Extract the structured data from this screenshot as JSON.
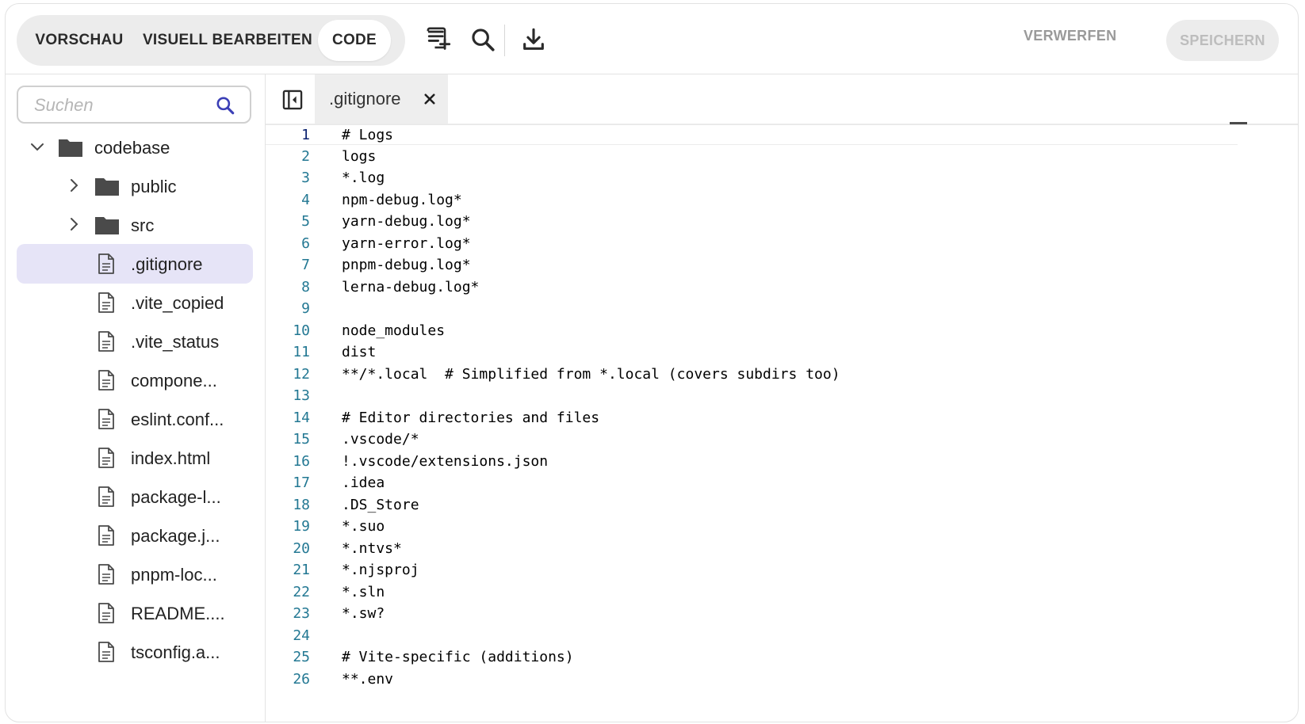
{
  "toolbar": {
    "modes": [
      {
        "label": "VORSCHAU",
        "active": false
      },
      {
        "label": "VISUELL BEARBEITEN",
        "active": false
      },
      {
        "label": "CODE",
        "active": true
      }
    ],
    "icons": [
      "add-file-icon",
      "search-icon",
      "download-icon"
    ],
    "discard_label": "VERWERFEN",
    "save_label": "SPEICHERN"
  },
  "sidebar": {
    "search_placeholder": "Suchen",
    "tree": [
      {
        "label": "codebase",
        "type": "folder",
        "expanded": true,
        "depth": 0
      },
      {
        "label": "public",
        "type": "folder",
        "expanded": false,
        "depth": 1
      },
      {
        "label": "src",
        "type": "folder",
        "expanded": false,
        "depth": 1
      },
      {
        "label": ".gitignore",
        "type": "file",
        "selected": true,
        "depth": 1
      },
      {
        "label": ".vite_copied",
        "type": "file",
        "depth": 1
      },
      {
        "label": ".vite_status",
        "type": "file",
        "depth": 1
      },
      {
        "label": "compone...",
        "type": "file",
        "depth": 1
      },
      {
        "label": "eslint.conf...",
        "type": "file",
        "depth": 1
      },
      {
        "label": "index.html",
        "type": "file",
        "depth": 1
      },
      {
        "label": "package-l...",
        "type": "file",
        "depth": 1
      },
      {
        "label": "package.j...",
        "type": "file",
        "depth": 1
      },
      {
        "label": "pnpm-loc...",
        "type": "file",
        "depth": 1
      },
      {
        "label": "README....",
        "type": "file",
        "depth": 1
      },
      {
        "label": "tsconfig.a...",
        "type": "file",
        "depth": 1
      }
    ]
  },
  "editor": {
    "tab": {
      "label": ".gitignore"
    },
    "active_line": 1,
    "lines": [
      "# Logs",
      "logs",
      "*.log",
      "npm-debug.log*",
      "yarn-debug.log*",
      "yarn-error.log*",
      "pnpm-debug.log*",
      "lerna-debug.log*",
      "",
      "node_modules",
      "dist",
      "**/*.local  # Simplified from *.local (covers subdirs too)",
      "",
      "# Editor directories and files",
      ".vscode/*",
      "!.vscode/extensions.json",
      ".idea",
      ".DS_Store",
      "*.suo",
      "*.ntvs*",
      "*.njsproj",
      "*.sln",
      "*.sw?",
      "",
      "# Vite-specific (additions)",
      "**.env"
    ]
  },
  "colors": {
    "selected_bg": "#e6e4f7",
    "line_number": "#237893",
    "search_icon": "#3b3fb6"
  }
}
